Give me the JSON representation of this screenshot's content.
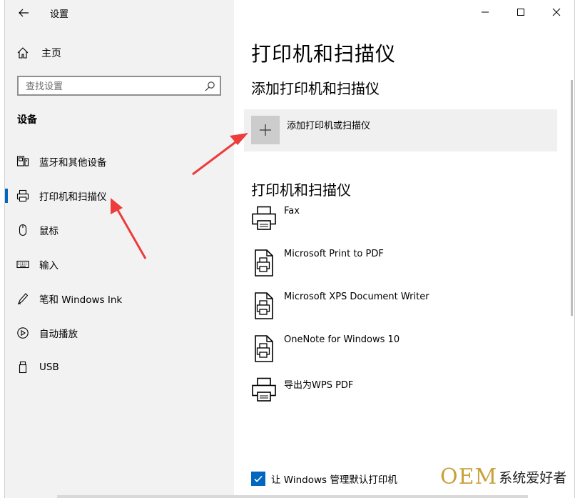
{
  "window": {
    "app_title": "设置",
    "controls": {
      "minimize": "minimize",
      "maximize": "maximize",
      "close": "close"
    }
  },
  "sidebar": {
    "home_label": "主页",
    "search_placeholder": "查找设置",
    "section_title": "设备",
    "items": [
      {
        "label": "蓝牙和其他设备",
        "icon": "bluetooth-devices-icon"
      },
      {
        "label": "打印机和扫描仪",
        "icon": "printer-icon",
        "active": true
      },
      {
        "label": "鼠标",
        "icon": "mouse-icon"
      },
      {
        "label": "输入",
        "icon": "keyboard-icon"
      },
      {
        "label": "笔和 Windows Ink",
        "icon": "pen-icon"
      },
      {
        "label": "自动播放",
        "icon": "autoplay-icon"
      },
      {
        "label": "USB",
        "icon": "usb-icon"
      }
    ]
  },
  "main": {
    "page_title": "打印机和扫描仪",
    "add_section_title": "添加打印机和扫描仪",
    "add_button_label": "添加打印机或扫描仪",
    "list_title": "打印机和扫描仪",
    "printers": [
      {
        "name": "Fax",
        "icon": "printer-icon"
      },
      {
        "name": "Microsoft Print to PDF",
        "icon": "document-printer-icon"
      },
      {
        "name": "Microsoft XPS Document Writer",
        "icon": "document-printer-icon"
      },
      {
        "name": "OneNote for Windows 10",
        "icon": "document-printer-icon"
      },
      {
        "name": "导出为WPS PDF",
        "icon": "printer-icon"
      }
    ],
    "default_printer_checkbox": {
      "label": "让 Windows 管理默认打印机",
      "checked": true
    }
  },
  "watermark": {
    "brand": "OEM",
    "text": "系统爱好者"
  },
  "colors": {
    "accent": "#0067c0",
    "sidebar_bg": "#f2f2f2",
    "annotation_arrow": "#ee3b3b",
    "watermark_gold": "#c8a13a"
  }
}
